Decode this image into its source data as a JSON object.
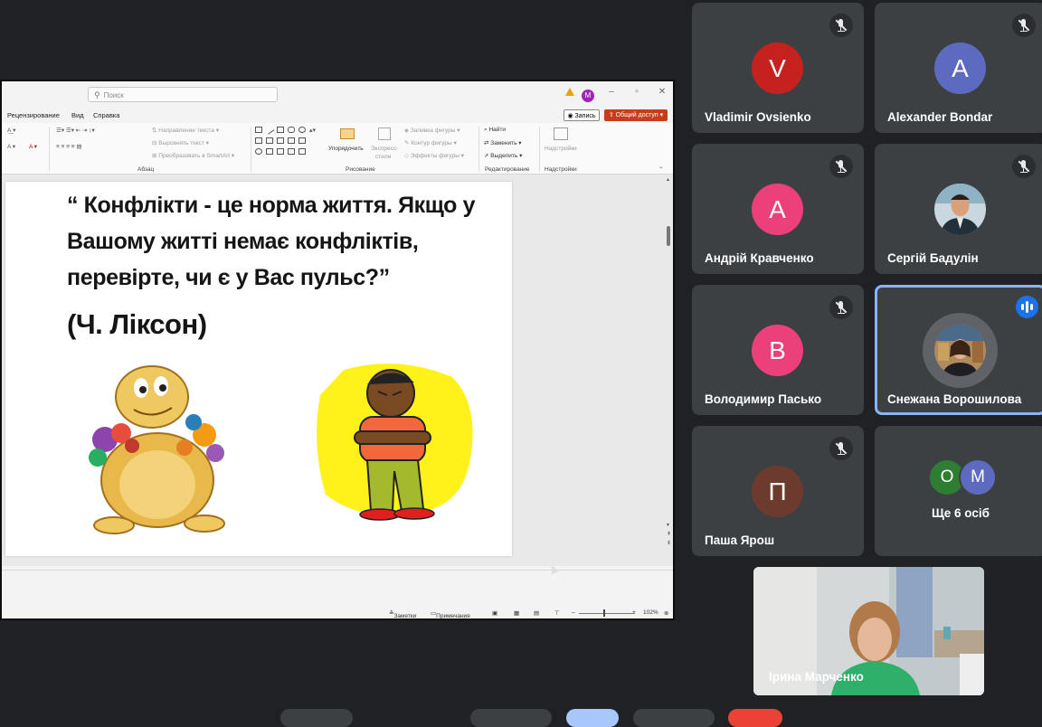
{
  "ppt": {
    "search_placeholder": "Поиск",
    "profile_initial": "М",
    "menu": [
      "Рецензирование",
      "Вид",
      "Справка"
    ],
    "record_label": "Запись",
    "share_label": "Общий доступ",
    "ribbon": {
      "text_direction": "Направление текста",
      "align_text": "Выровнять текст",
      "smartart": "Преобразовать в SmartArt",
      "paragraph_group": "Абзац",
      "arrange": "Упорядочить",
      "quick_styles_1": "Экспресс-",
      "quick_styles_2": "стили",
      "shape_fill": "Заливка фигуры",
      "shape_outline": "Контур фигуры",
      "shape_effects": "Эффекты фигуры",
      "drawing_group": "Рисование",
      "find": "Найти",
      "replace": "Заменить",
      "select": "Выделить",
      "editing_group": "Редактирование",
      "addins": "Надстройки",
      "addins_group": "Надстройки"
    },
    "slide": {
      "quote_l1": "“ Конфлікти - це норма життя. Якщо у",
      "quote_l2": "Вашому житті немає конфліктів,",
      "quote_l3": "перевірте, чи є у Вас пульс?”",
      "author": "(Ч. Ліксон)"
    },
    "status": {
      "notes": "Заметки",
      "comments": "Примечания",
      "zoom": "102%"
    }
  },
  "participants": [
    {
      "name": "Vladimir Ovsienko",
      "initial": "V",
      "color": "#c5221f"
    },
    {
      "name": "Alexander Bondar",
      "initial": "A",
      "color": "#5c6bc0"
    },
    {
      "name": "Андрій Кравченко",
      "initial": "A",
      "color": "#ec407a"
    },
    {
      "name": "Сергій Бадулін"
    },
    {
      "name": "Володимир Пасько",
      "initial": "B",
      "color": "#ec407a"
    },
    {
      "name": "Снежана Ворошилова"
    },
    {
      "name": "Паша Ярош",
      "initial": "П",
      "color": "#6d3b2e"
    }
  ],
  "more": {
    "label": "Ще 6 осіб",
    "initials": [
      "O",
      "M"
    ],
    "colors": [
      "#2e7d32",
      "#5c6bc0"
    ]
  },
  "self": {
    "name": "Ірина Марченко"
  }
}
